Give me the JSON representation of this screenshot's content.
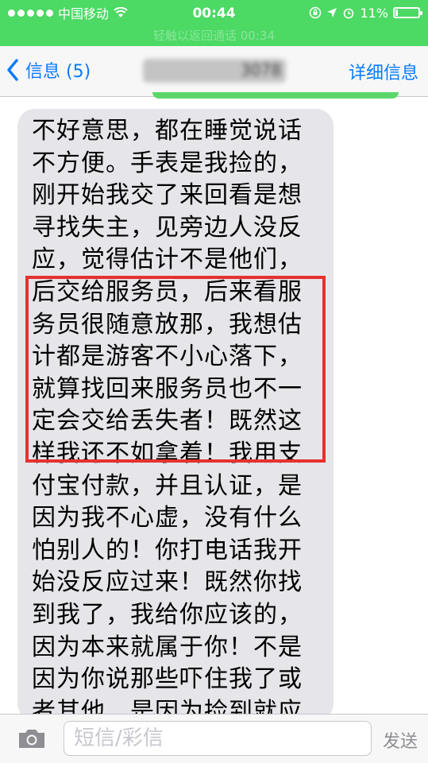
{
  "status_bar": {
    "carrier": "中国移动",
    "time": "00:44",
    "battery_percent": "11%",
    "battery_level": 0.11
  },
  "call_banner": "轻触以返回通话  00:34",
  "nav": {
    "back_label": "信息 (5)",
    "contact": "3078",
    "details_label": "详细信息"
  },
  "message": {
    "lines": [
      "不好意思，都在睡觉说话",
      "不方便。手表是我捡的，",
      "刚开始我交了来回看是想",
      "寻找失主，见旁边人没反",
      "应，觉得估计不是他们，",
      "后交给服务员，后来看服",
      "务员很随意放那，我想估",
      "计都是游客不小心落下，",
      "就算找回来服务员也不一",
      "定会交给丢失者！既然这",
      "样我还不如拿着！我用支",
      "付宝付款，并且认证，是",
      "因为我不心虚，没有什么",
      "怕别人的！你打电话我开",
      "始没反应过来！既然你找",
      "到我了，我给你应该的，",
      "因为本来就属于你！不是",
      "因为你说那些吓住我了或",
      "者其他，是因为捡到就应"
    ]
  },
  "input": {
    "placeholder": "短信/彩信",
    "send_label": "发送"
  },
  "colors": {
    "status_green": "#4cd964",
    "ios_blue": "#0a7aff",
    "bubble_gray": "#e5e5ea",
    "highlight_red": "#e5322e"
  },
  "icons": [
    "signal-dots-icon",
    "wifi-icon",
    "lock-rotation-icon",
    "location-icon",
    "alarm-icon",
    "battery-icon",
    "back-chevron-icon",
    "camera-icon"
  ]
}
